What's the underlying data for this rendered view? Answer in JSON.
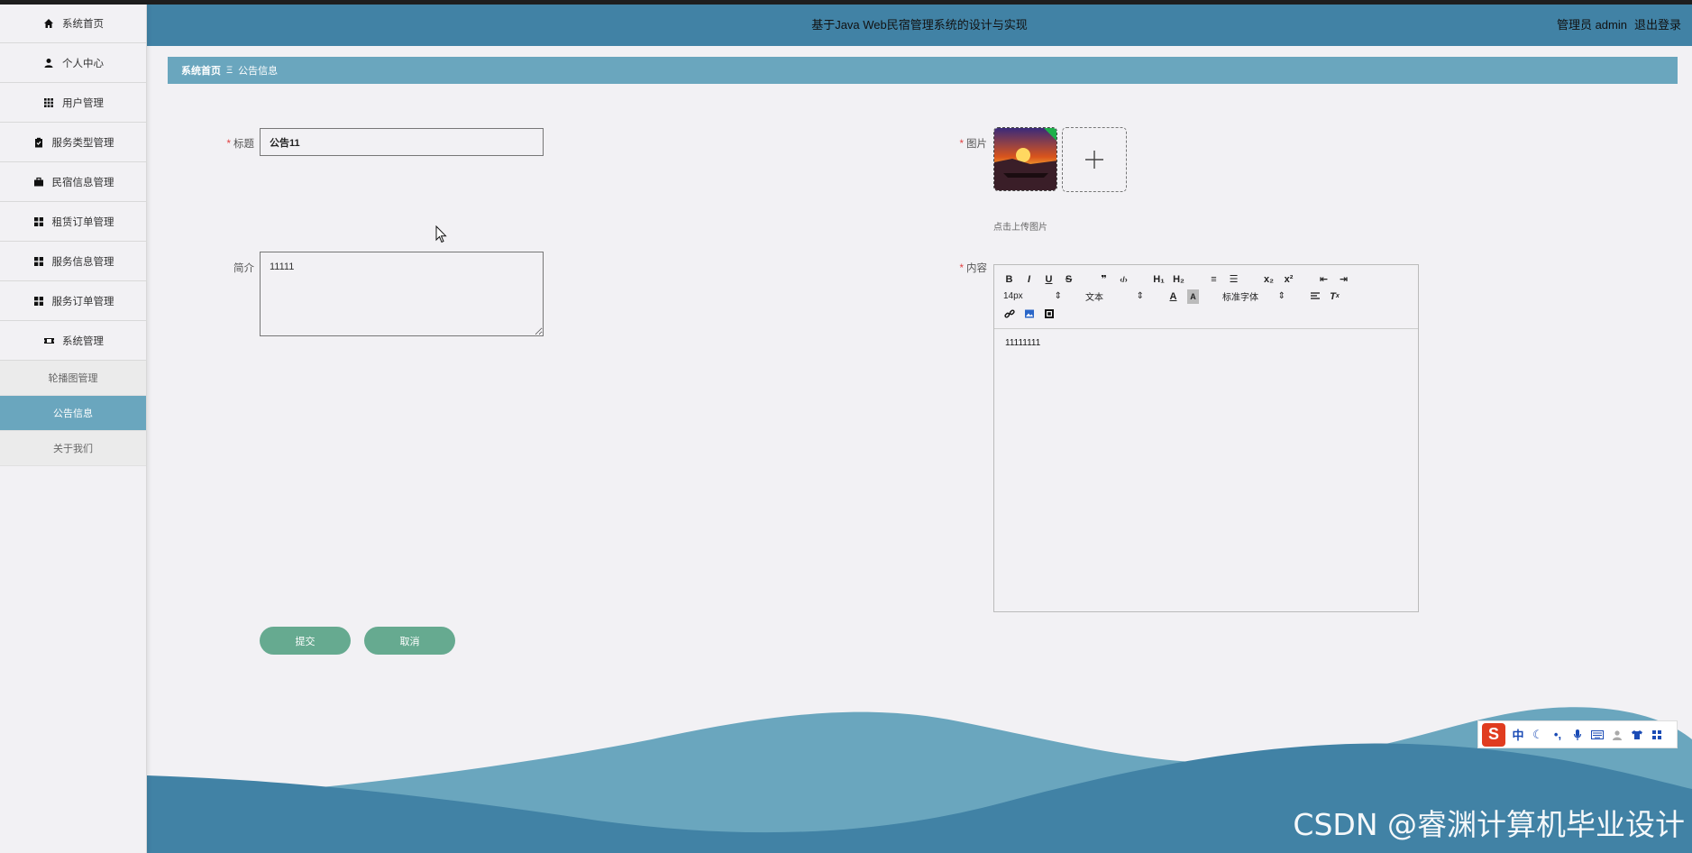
{
  "header": {
    "title": "基于Java Web民宿管理系统的设计与实现",
    "user": "管理员 admin",
    "logout": "退出登录"
  },
  "sidebar": {
    "items": [
      {
        "label": "系统首页",
        "icon": "home-icon"
      },
      {
        "label": "个人中心",
        "icon": "person-icon"
      },
      {
        "label": "用户管理",
        "icon": "grid-icon"
      },
      {
        "label": "服务类型管理",
        "icon": "clipboard-icon"
      },
      {
        "label": "民宿信息管理",
        "icon": "briefcase-icon"
      },
      {
        "label": "租赁订单管理",
        "icon": "apps-icon"
      },
      {
        "label": "服务信息管理",
        "icon": "apps-icon"
      },
      {
        "label": "服务订单管理",
        "icon": "apps-icon"
      },
      {
        "label": "系统管理",
        "icon": "ticket-icon"
      }
    ],
    "subitems": [
      {
        "label": "轮播图管理",
        "active": false
      },
      {
        "label": "公告信息",
        "active": true
      },
      {
        "label": "关于我们",
        "active": false
      }
    ]
  },
  "breadcrumb": {
    "home": "系统首页",
    "separator": "Ξ",
    "current": "公告信息"
  },
  "form": {
    "title_label": "标题",
    "title_value": "公告11",
    "intro_label": "简介",
    "intro_value": "11111",
    "image_label": "图片",
    "upload_tip": "点击上传图片",
    "content_label": "内容",
    "content_value": "11111111",
    "required_mark": "*"
  },
  "editor": {
    "row1": [
      "B",
      "I",
      "U",
      "S",
      "❞",
      "‹/›",
      "H₁",
      "H₂",
      "≡",
      "☰",
      "x₂",
      "x²",
      "⇤",
      "⇥"
    ],
    "font_size": "14px",
    "text_type": "文本",
    "font_family": "标准字体"
  },
  "buttons": {
    "submit": "提交",
    "cancel": "取消"
  },
  "ime": {
    "logo": "S",
    "mode": "中"
  },
  "watermark": "CSDN @睿渊计算机毕业设计",
  "colors": {
    "header": "#4182a5",
    "breadcrumb": "#6aa6be",
    "button": "#66aa90",
    "active_menu": "#6aa6be"
  }
}
